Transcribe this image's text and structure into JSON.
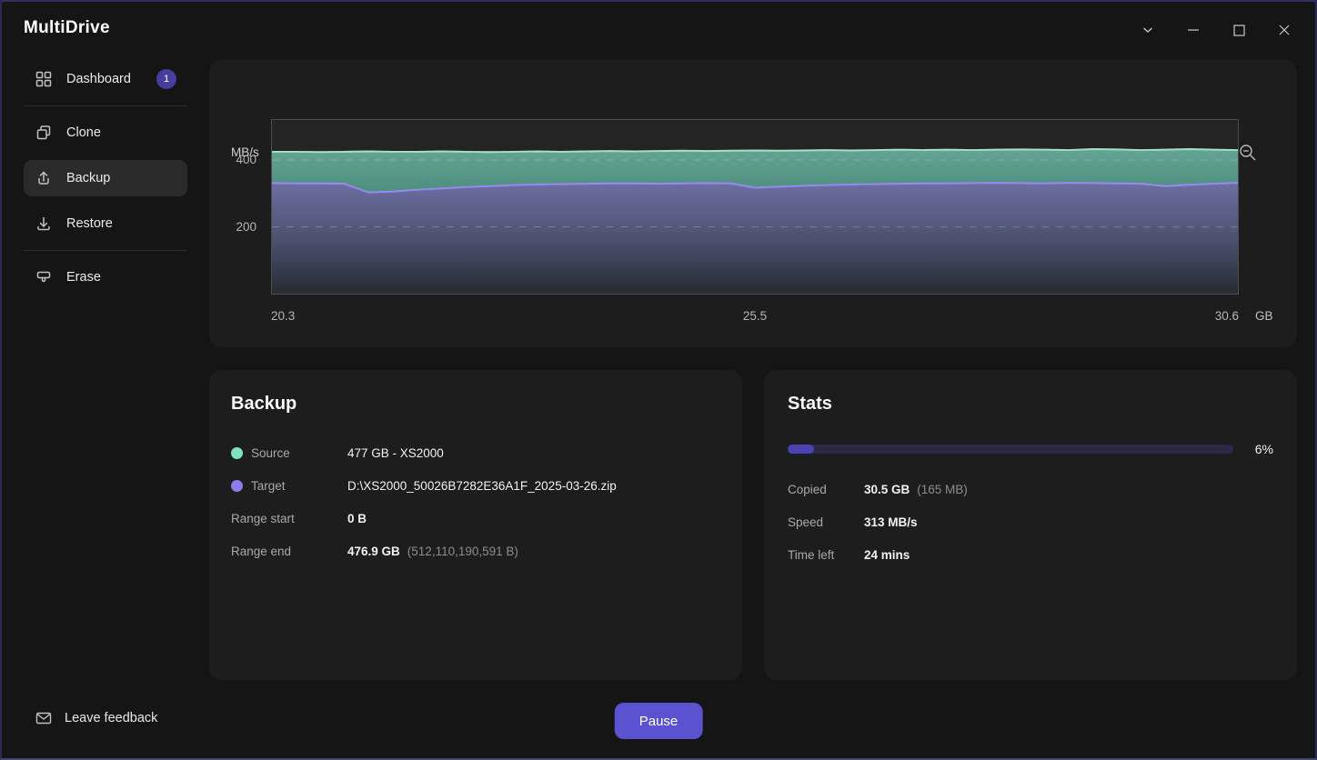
{
  "app": {
    "brand": "MultiDrive"
  },
  "titlebar": {
    "controls": [
      "collapse-chevron",
      "minimize",
      "maximize",
      "close"
    ]
  },
  "sidebar": {
    "items": [
      {
        "label": "Dashboard",
        "icon": "grid",
        "badge": "1",
        "selected": false,
        "divider_after": true
      },
      {
        "label": "Clone",
        "icon": "clone",
        "selected": false,
        "divider_after": false
      },
      {
        "label": "Backup",
        "icon": "upload",
        "selected": true,
        "divider_after": false
      },
      {
        "label": "Restore",
        "icon": "download",
        "selected": false,
        "divider_after": true
      },
      {
        "label": "Erase",
        "icon": "eraser",
        "selected": false,
        "divider_after": false
      }
    ],
    "feedback_label": "Leave feedback"
  },
  "chart_data": {
    "type": "area",
    "title": "",
    "ylabel": "MB/s",
    "xlabel": "GB",
    "x_unit": "GB",
    "y_ticks": [
      200,
      400
    ],
    "x_ticks": [
      "20.3",
      "25.5",
      "30.6"
    ],
    "xlim": [
      20.3,
      30.6
    ],
    "ylim": [
      0,
      520
    ],
    "grid": "dashed-horizontal",
    "legend": "none",
    "series": [
      {
        "name": "source-read-speed",
        "line_color": "#a9dec7",
        "fill_color_top": "#63a492",
        "fill_color_bottom": "#4e8e7f",
        "values": [
          425,
          425,
          424,
          425,
          426,
          425,
          425,
          426,
          425,
          424,
          425,
          426,
          425,
          426,
          427,
          426,
          427,
          428,
          427,
          428,
          429,
          428,
          429,
          430,
          429,
          430,
          431,
          430,
          431,
          430,
          431,
          432,
          431,
          430,
          433,
          432,
          430,
          431,
          433,
          431,
          430
        ]
      },
      {
        "name": "target-write-speed",
        "line_color": "#948af0",
        "fill_color_top": "#6e6ea3",
        "fill_color_mid": "#4b516e",
        "fill_color_bottom": "#262b33",
        "values": [
          331,
          330,
          330,
          329,
          303,
          306,
          311,
          315,
          319,
          322,
          325,
          327,
          328,
          329,
          330,
          330,
          329,
          330,
          331,
          330,
          317,
          320,
          323,
          325,
          327,
          328,
          329,
          330,
          330,
          331,
          332,
          331,
          330,
          332,
          331,
          330,
          329,
          322,
          326,
          329,
          332
        ]
      }
    ]
  },
  "backup_card": {
    "title": "Backup",
    "rows": [
      {
        "label": "Source",
        "dot_color": "#7fe0c4",
        "value": "477 GB - XS2000",
        "note": ""
      },
      {
        "label": "Target",
        "dot_color": "#8f7bea",
        "value": "D:\\XS2000_50026B7282E36A1F_2025-03-26.zip",
        "note": ""
      },
      {
        "label": "Range start",
        "dot_color": "",
        "value": "0 B",
        "note": ""
      },
      {
        "label": "Range end",
        "dot_color": "",
        "value": "476.9 GB",
        "note": "(512,110,190,591 B)"
      }
    ]
  },
  "stats_card": {
    "title": "Stats",
    "progress_percent": 6,
    "progress_label": "6%",
    "progress_fill_color": "#4a43b4",
    "progress_track_color": "#2c2947",
    "rows": [
      {
        "label": "Copied",
        "value": "30.5 GB",
        "note": "(165 MB)"
      },
      {
        "label": "Speed",
        "value": "313 MB/s",
        "note": ""
      },
      {
        "label": "Time left",
        "value": "24 mins",
        "note": ""
      }
    ]
  },
  "footer": {
    "pause_label": "Pause"
  }
}
